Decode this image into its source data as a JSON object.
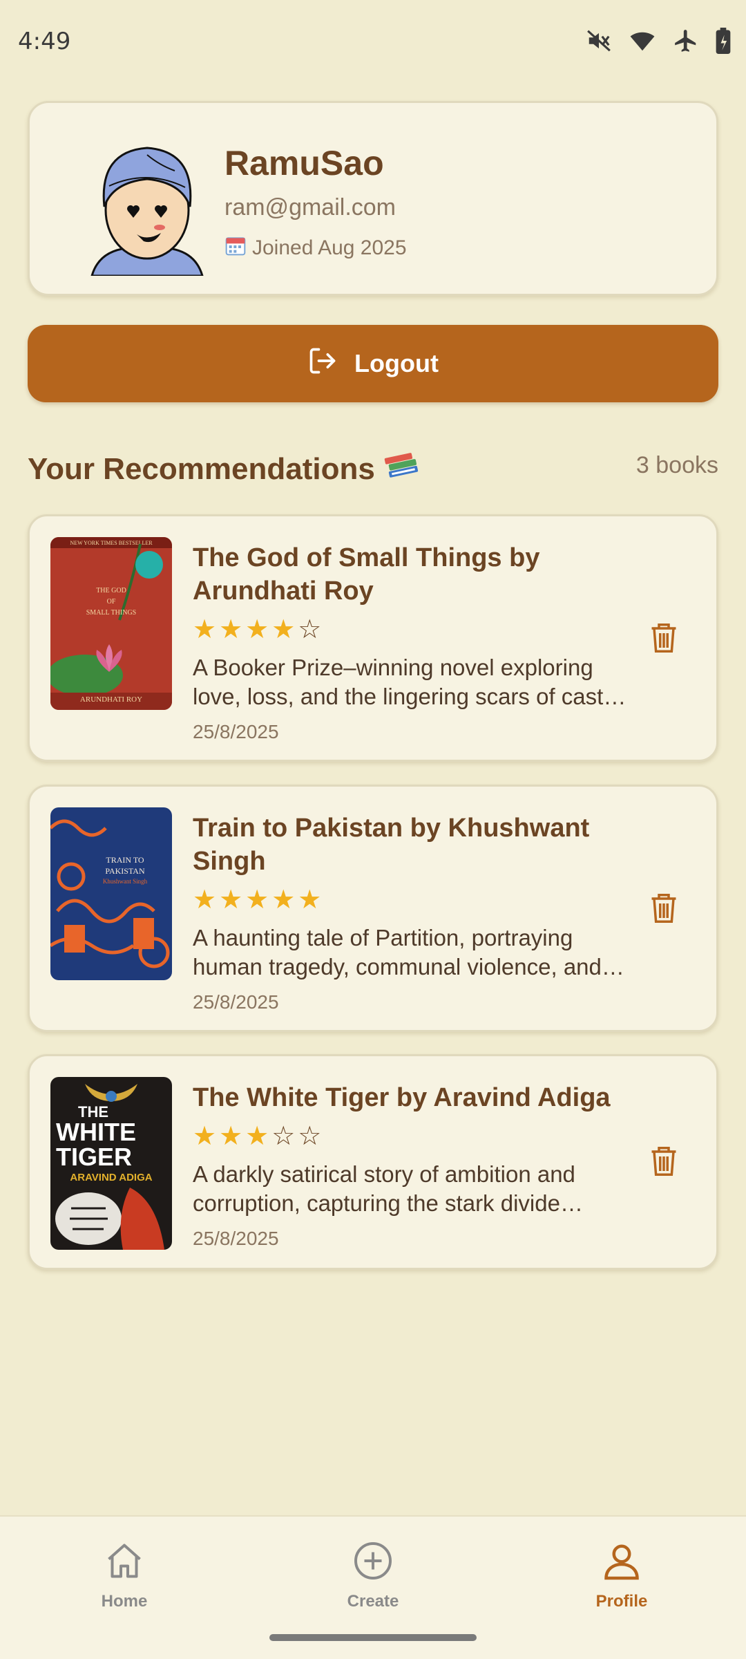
{
  "status_bar": {
    "time": "4:49",
    "icons": [
      "mute-icon",
      "wifi-icon",
      "airplane-icon",
      "battery-icon"
    ]
  },
  "profile": {
    "username": "RamuSao",
    "email": "ram@gmail.com",
    "joined": "Joined Aug 2025"
  },
  "logout": {
    "label": "Logout"
  },
  "recommendations": {
    "title": "Your Recommendations",
    "count": "3 books",
    "books": [
      {
        "title": "The God of Small Things by Arundhati Roy",
        "rating": 4,
        "description": "A Booker Prize–winning novel exploring love, loss, and the lingering scars of caste and family history in Kerala.",
        "date": "25/8/2025",
        "cover": {
          "author": "ARUNDHATI ROY",
          "line1": "THE GOD",
          "line2": "OF",
          "line3": "SMALL THINGS",
          "top_line": "NEW YORK TIMES BESTSELLER",
          "bg": "#b33a2a"
        }
      },
      {
        "title": "Train to Pakistan by Khushwant Singh",
        "rating": 5,
        "description": "A haunting tale of Partition, portraying human tragedy, communal violence, and the power of love.",
        "date": "25/8/2025",
        "cover": {
          "line1": "TRAIN TO",
          "line2": "PAKISTAN",
          "author": "Khushwant Singh",
          "bg": "#1f3a7a"
        }
      },
      {
        "title": "The White Tiger by Aravind Adiga",
        "rating": 3,
        "description": "A darkly satirical story of ambition and corruption, capturing the stark divide between rich and poor.",
        "date": "25/8/2025",
        "cover": {
          "line1": "THE",
          "line2": "WHITE",
          "line3": "TIGER",
          "author": "ARAVIND ADIGA",
          "bg": "#1e1a18"
        }
      }
    ]
  },
  "nav": {
    "items": [
      {
        "label": "Home",
        "icon": "home-icon",
        "active": false
      },
      {
        "label": "Create",
        "icon": "plus-circle-icon",
        "active": false
      },
      {
        "label": "Profile",
        "icon": "person-icon",
        "active": true
      }
    ]
  },
  "colors": {
    "background": "#f1ecd0",
    "card": "#f7f3e2",
    "accent": "#b5651d",
    "text_primary": "#6b4423",
    "star": "#f2b01e"
  }
}
